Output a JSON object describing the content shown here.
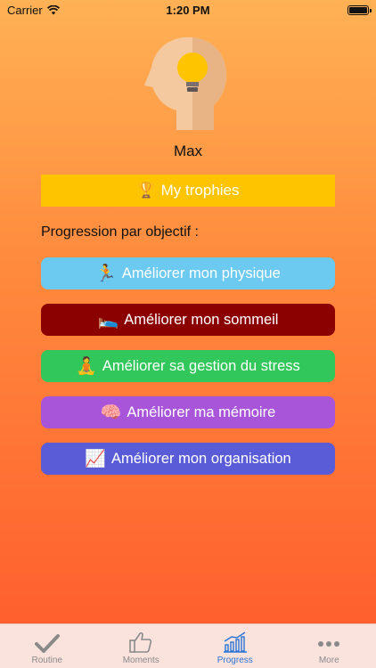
{
  "status_bar": {
    "carrier": "Carrier",
    "time": "1:20 PM"
  },
  "profile": {
    "name": "Max"
  },
  "trophies": {
    "icon": "🏆",
    "label": "My trophies",
    "color": "#ffc400"
  },
  "section_label": "Progression par objectif :",
  "goals": [
    {
      "icon": "🏃",
      "label": "Améliorer mon physique",
      "color": "#6cc9f0"
    },
    {
      "icon": "🛌",
      "label": "Améliorer mon sommeil",
      "color": "#8b0000"
    },
    {
      "icon": "🧘",
      "label": "Améliorer sa gestion du stress",
      "color": "#31c75b"
    },
    {
      "icon": "🧠",
      "label": "Améliorer ma mémoire",
      "color": "#a855d9"
    },
    {
      "icon": "📈",
      "label": "Améliorer mon organisation",
      "color": "#5a5bd6"
    }
  ],
  "tabs": [
    {
      "label": "Routine",
      "icon": "checkmark-icon"
    },
    {
      "label": "Moments",
      "icon": "thumbs-up-icon"
    },
    {
      "label": "Progress",
      "icon": "progress-chart-icon",
      "active": true
    },
    {
      "label": "More",
      "icon": "more-dots-icon"
    }
  ]
}
